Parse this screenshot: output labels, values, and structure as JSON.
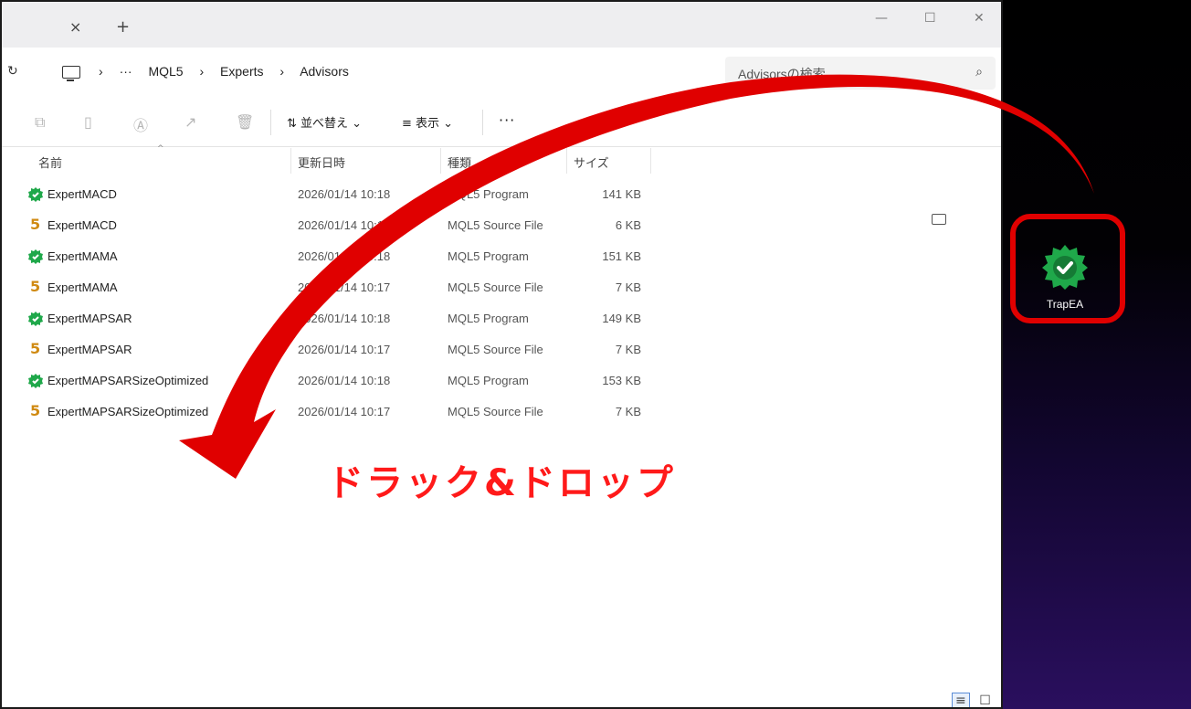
{
  "window": {
    "tab_close": "×",
    "tab_add": "+",
    "minimize": "—",
    "maximize": "☐",
    "close": "✕"
  },
  "address": {
    "refresh": "↻",
    "breadcrumbs": [
      "›",
      "···",
      "MQL5",
      "›",
      "Experts",
      "›",
      "Advisors"
    ],
    "search_placeholder": "Advisorsの検索",
    "search_icon": "⌕"
  },
  "toolbar": {
    "sort_label": "⇅ 並べ替え ⌄",
    "view_label": "≡ 表示 ⌄",
    "more_label": "···"
  },
  "columns": {
    "name": "名前",
    "date": "更新日時",
    "type": "種類",
    "size": "サイズ",
    "sort_caret": "^"
  },
  "files": [
    {
      "name": "ExpertMACD",
      "date": "2026/01/14 10:18",
      "type": "MQL5 Program",
      "size": "141 KB",
      "icon": "mql5-program-icon"
    },
    {
      "name": "ExpertMACD",
      "date": "2026/01/14 10:17",
      "type": "MQL5 Source File",
      "size": "6 KB",
      "icon": "mql5-source-icon"
    },
    {
      "name": "ExpertMAMA",
      "date": "2026/01/14 10:18",
      "type": "MQL5 Program",
      "size": "151 KB",
      "icon": "mql5-program-icon"
    },
    {
      "name": "ExpertMAMA",
      "date": "2026/01/14 10:17",
      "type": "MQL5 Source File",
      "size": "7 KB",
      "icon": "mql5-source-icon"
    },
    {
      "name": "ExpertMAPSAR",
      "date": "2026/01/14 10:18",
      "type": "MQL5 Program",
      "size": "149 KB",
      "icon": "mql5-program-icon"
    },
    {
      "name": "ExpertMAPSAR",
      "date": "2026/01/14 10:17",
      "type": "MQL5 Source File",
      "size": "7 KB",
      "icon": "mql5-source-icon"
    },
    {
      "name": "ExpertMAPSARSizeOptimized",
      "date": "2026/01/14 10:18",
      "type": "MQL5 Program",
      "size": "153 KB",
      "icon": "mql5-program-icon"
    },
    {
      "name": "ExpertMAPSARSizeOptimized",
      "date": "2026/01/14 10:17",
      "type": "MQL5 Source File",
      "size": "7 KB",
      "icon": "mql5-source-icon"
    }
  ],
  "source_glyph": "5",
  "desktop": {
    "icon_label": "TrapEA"
  },
  "annotation": {
    "drag_text": "ドラック&ドロップ",
    "arrow_color": "#e00000"
  },
  "view_toggle": {
    "list": "≡",
    "tiles": "☐"
  }
}
